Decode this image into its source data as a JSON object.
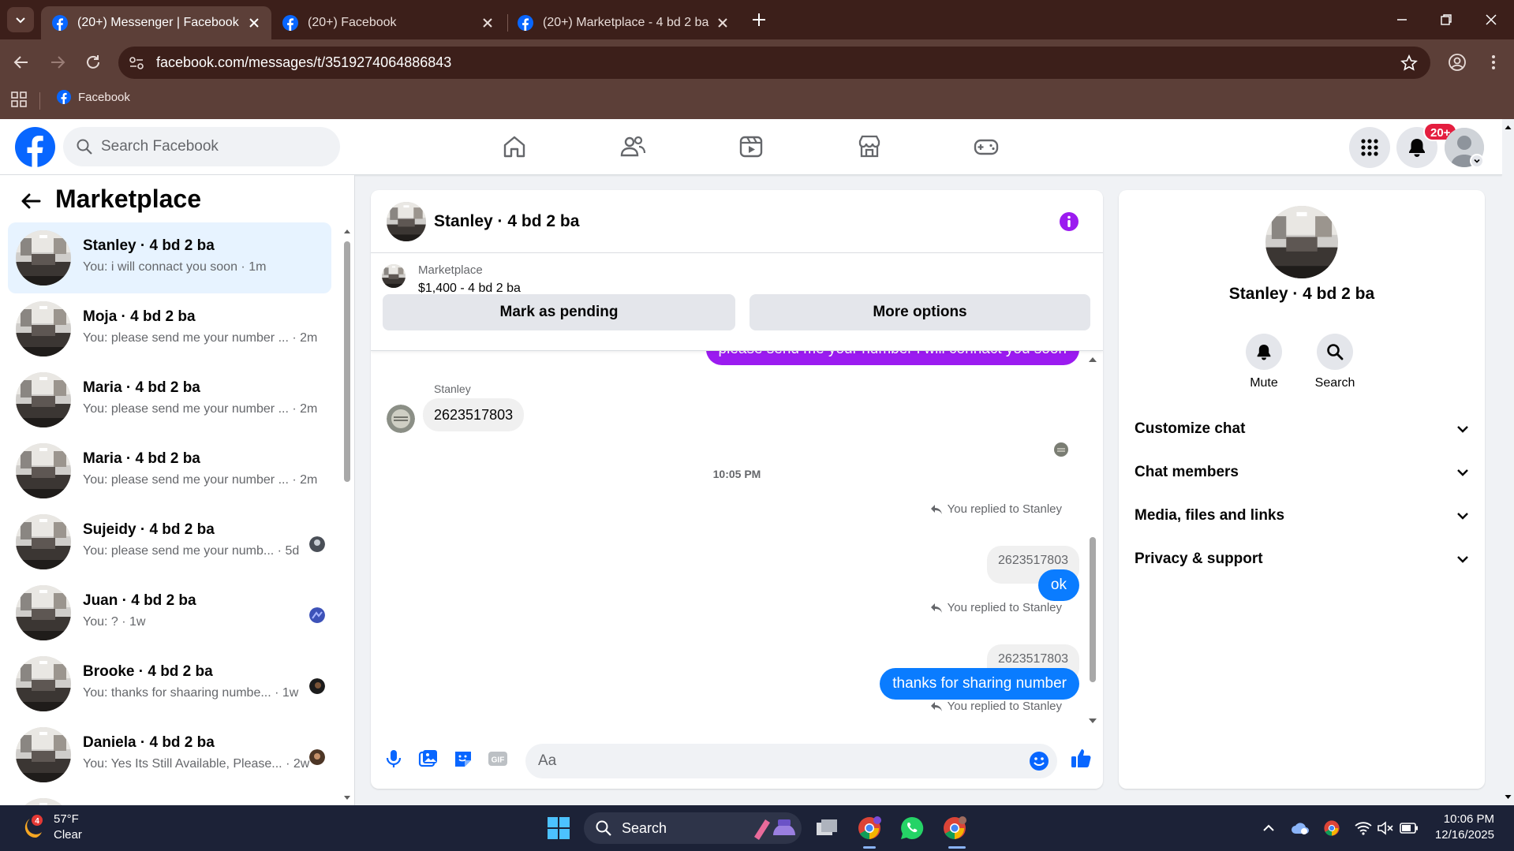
{
  "browser": {
    "tabs": [
      {
        "title": "(20+) Messenger | Facebook",
        "active": true
      },
      {
        "title": "(20+) Facebook",
        "active": false
      },
      {
        "title": "(20+) Marketplace - 4 bd 2 ba |",
        "active": false
      }
    ],
    "url": "facebook.com/messages/t/3519274064886843",
    "bookmarks": [
      {
        "label": "Facebook"
      }
    ]
  },
  "fb_header": {
    "search_placeholder": "Search Facebook",
    "notification_badge": "20+"
  },
  "sidebar": {
    "title": "Marketplace",
    "conversations": [
      {
        "name": "Stanley · 4 bd 2 ba",
        "preview": "You: i will connact you soon · 1m",
        "active": true
      },
      {
        "name": "Moja · 4 bd 2 ba",
        "preview": "You: please send me your number ... · 2m"
      },
      {
        "name": "Maria · 4 bd 2 ba",
        "preview": "You: please send me your number ... · 2m"
      },
      {
        "name": "Maria · 4 bd 2 ba",
        "preview": "You: please send me your number ... · 2m"
      },
      {
        "name": "Sujeidy · 4 bd 2 ba",
        "preview": "You: please send me your numb... · 5d"
      },
      {
        "name": "Juan · 4 bd 2 ba",
        "preview": "You: ? · 1w"
      },
      {
        "name": "Brooke · 4 bd 2 ba",
        "preview": "You: thanks for shaaring numbe... · 1w"
      },
      {
        "name": "Daniela · 4 bd 2 ba",
        "preview": "You: Yes Its Still Available, Please... · 2w"
      }
    ]
  },
  "chat": {
    "title": "Stanley · 4 bd 2 ba",
    "listing": {
      "category": "Marketplace",
      "price": "$1,400 - 4 bd 2 ba",
      "mark_pending_label": "Mark as pending",
      "more_options_label": "More options"
    },
    "messages": {
      "outgoing_top": "please send me your number i will connact you soon",
      "sender_label": "Stanley",
      "incoming_number": "2623517803",
      "timestamp": "10:05 PM",
      "reply1_label": "You replied to Stanley",
      "reply1_ref": "2623517803",
      "reply1_text": "ok",
      "reply2_label": "You replied to Stanley",
      "reply2_ref": "2623517803",
      "reply2_text": "thanks for sharing number",
      "reply3_label": "You replied to Stanley"
    },
    "composer_placeholder": "Aa"
  },
  "info_panel": {
    "name": "Stanley · 4 bd 2 ba",
    "actions": [
      {
        "label": "Mute",
        "icon": "bell-icon"
      },
      {
        "label": "Search",
        "icon": "search-icon"
      }
    ],
    "sections": [
      {
        "label": "Customize chat"
      },
      {
        "label": "Chat members"
      },
      {
        "label": "Media, files and links"
      },
      {
        "label": "Privacy & support"
      }
    ]
  },
  "taskbar": {
    "weather_temp": "57°F",
    "weather_desc": "Clear",
    "weather_badge": "4",
    "search_label": "Search",
    "time": "10:06 PM",
    "date": "12/16/2025"
  },
  "colors": {
    "facebook_blue": "#0866ff",
    "messenger_out": "#0a7cff",
    "messenger_purple": "#9b1bf0",
    "active_conv_bg": "#e7f3ff",
    "chrome_frame": "#3c1f1a"
  }
}
